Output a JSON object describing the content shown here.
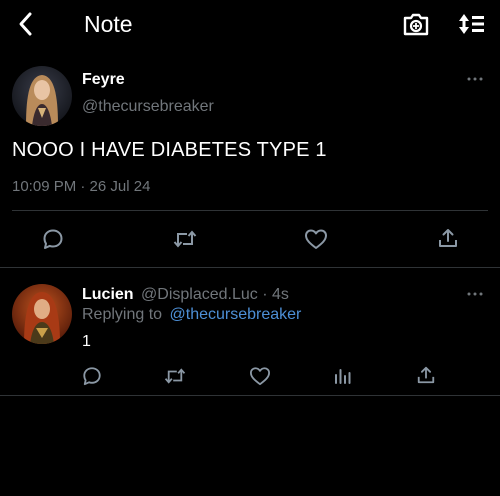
{
  "header": {
    "title": "Note"
  },
  "tweet": {
    "name": "Feyre",
    "handle": "@thecursebreaker",
    "text": "NOOO I HAVE DIABETES TYPE 1",
    "timestamp": "10:09 PM · 26 Jul 24"
  },
  "reply": {
    "name": "Lucien",
    "handle_time": "@Displaced.Luc · 4s",
    "replying_prefix": "Replying to",
    "replying_handle": "@thecursebreaker",
    "text": "1"
  },
  "colors": {
    "background": "#000000",
    "link": "#4d8fd6",
    "muted": "#71767b"
  }
}
